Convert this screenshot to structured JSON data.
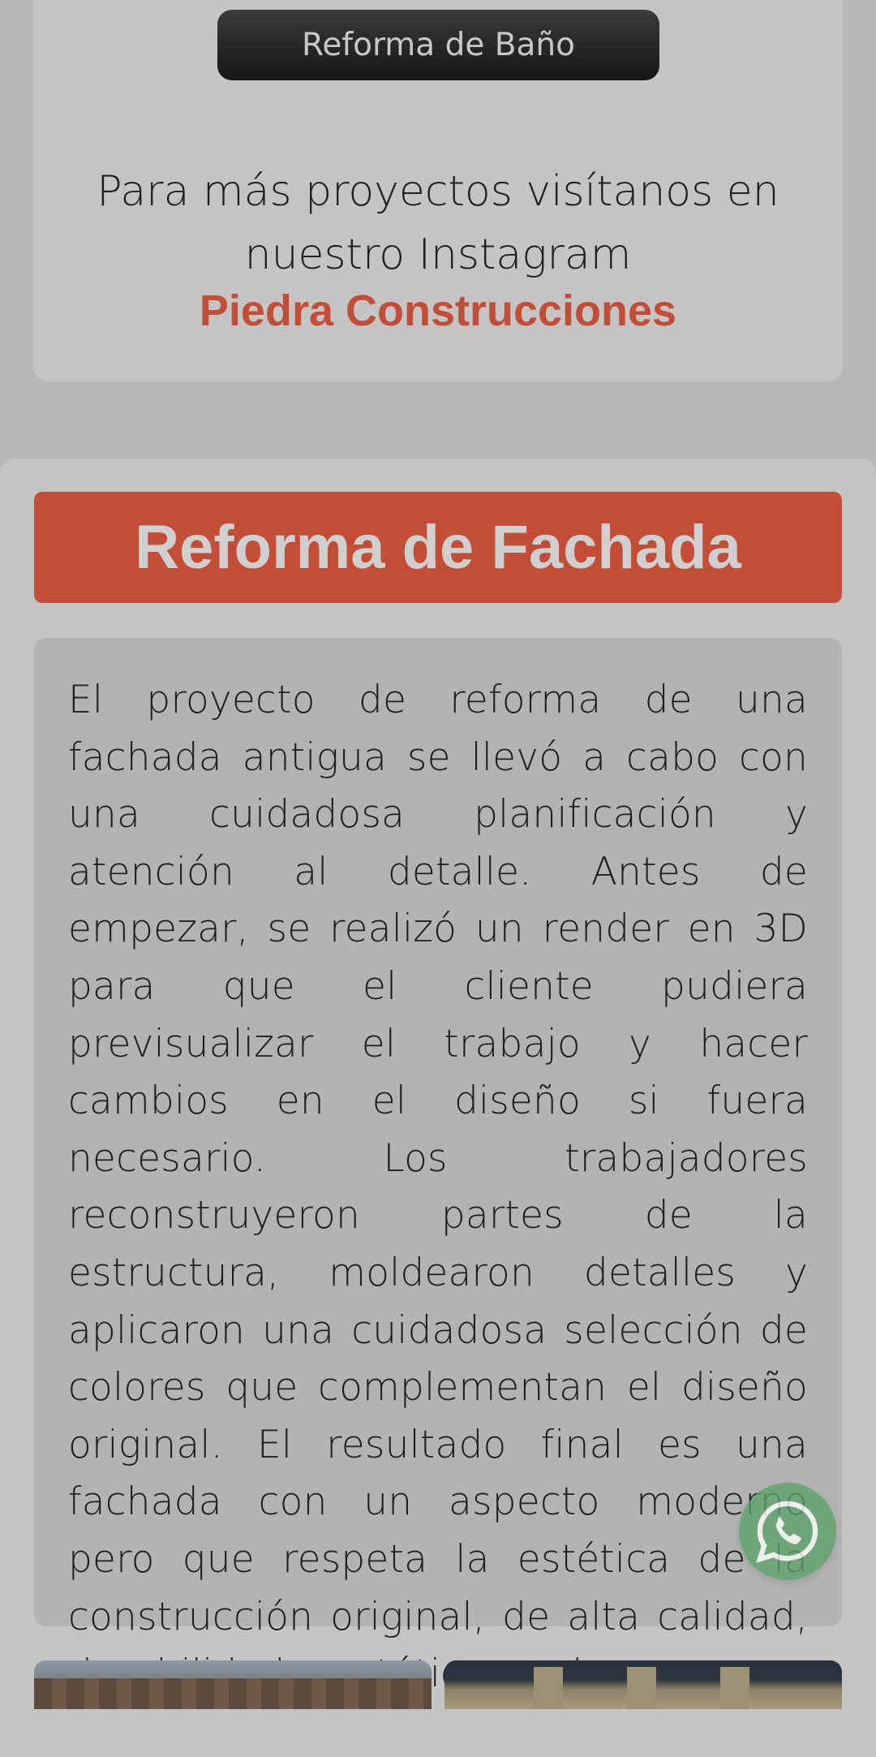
{
  "project_button": {
    "label": "Reforma de Baño"
  },
  "instagram": {
    "line1": "Para más proyectos visítanos en",
    "line2": "nuestro Instagram",
    "link_text": "Piedra Construcciones"
  },
  "section": {
    "title": "Reforma de Fachada",
    "description": "El proyecto de reforma de una fachada antigua se llevó a cabo con una cuidadosa planificación y atención al detalle. Antes de empezar, se realizó un render en 3D para que el cliente pudiera previsualizar el trabajo y hacer cambios en el diseño si fuera necesario. Los trabajadores reconstruyeron partes de la estructura, moldearon detalles y aplicaron una cuidadosa selección de colores que complementan el diseño original. El resultado final es una fachada con un aspecto moderno pero que respeta la estética de la construcción original, de alta calidad, durabilidad y estética moderna."
  },
  "colors": {
    "accent": "#c34e38",
    "page_background": "#b7b7b7",
    "card_background": "#c4c4c4",
    "whatsapp": "#5da36a"
  },
  "icons": {
    "floating": "whatsapp-icon"
  }
}
